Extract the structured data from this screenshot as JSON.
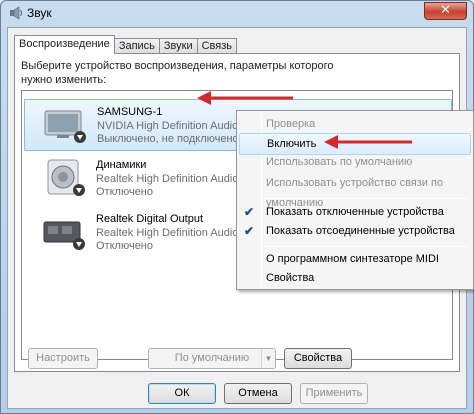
{
  "window": {
    "title": "Звук",
    "close_symbol": "✕"
  },
  "tabs": [
    {
      "label": "Воспроизведение",
      "active": true
    },
    {
      "label": "Запись"
    },
    {
      "label": "Звуки"
    },
    {
      "label": "Связь"
    }
  ],
  "instruction": "Выберите устройство воспроизведения, параметры которого нужно изменить:",
  "devices": [
    {
      "name": "SAMSUNG-1",
      "driver": "NVIDIA High Definition Audio",
      "status": "Выключено, не подключено",
      "icon": "monitor-speaker-icon",
      "selected": true
    },
    {
      "name": "Динамики",
      "driver": "Realtek High Definition Audio",
      "status": "Отключено",
      "icon": "speaker-icon"
    },
    {
      "name": "Realtek Digital Output",
      "driver": "Realtek High Definition Audio",
      "status": "Отключено",
      "icon": "digital-output-icon"
    }
  ],
  "buttons": {
    "configure": "Настроить",
    "default": "По умолчанию",
    "properties": "Свойства",
    "ok": "ОК",
    "cancel": "Отмена",
    "apply": "Применить"
  },
  "context_menu": {
    "items": [
      {
        "label": "Проверка",
        "disabled": true
      },
      {
        "label": "Включить",
        "hover": true
      },
      {
        "label": "Использовать по умолчанию",
        "disabled": true
      },
      {
        "label": "Использовать устройство связи по умолчанию",
        "disabled": true
      },
      {
        "label": "Показать отключенные устройства",
        "checked": true
      },
      {
        "label": "Показать отсоединенные устройства",
        "checked": true
      },
      {
        "label": "О программном синтезаторе MIDI"
      },
      {
        "label": "Свойства"
      }
    ],
    "check_symbol": "✔"
  },
  "colors": {
    "annotation_arrow": "#d42a2a",
    "selection": "#d2e8fb"
  }
}
